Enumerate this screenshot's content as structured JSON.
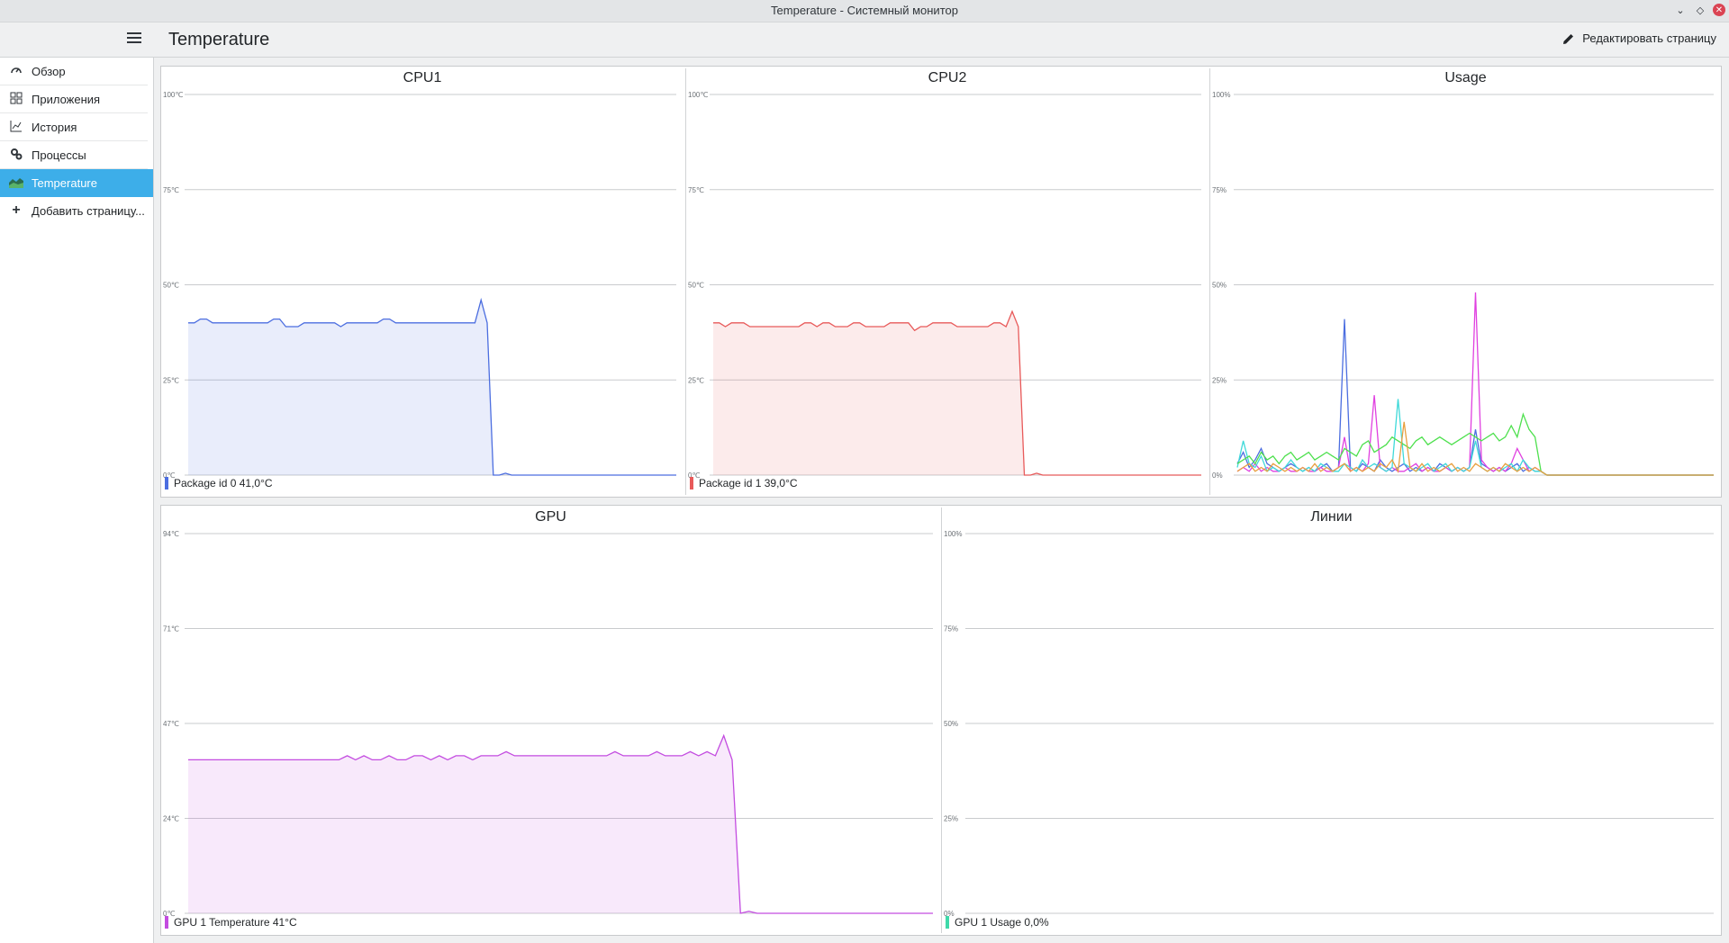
{
  "window": {
    "title": "Temperature - Системный монитор"
  },
  "header": {
    "page_title": "Temperature",
    "edit_label": "Редактировать страницу"
  },
  "sidebar": {
    "items": [
      {
        "label": "Обзор",
        "icon": "speedometer-icon"
      },
      {
        "label": "Приложения",
        "icon": "grid-icon"
      },
      {
        "label": "История",
        "icon": "history-chart-icon"
      },
      {
        "label": "Процессы",
        "icon": "gears-icon"
      },
      {
        "label": "Temperature",
        "icon": "area-chart-icon",
        "active": true
      },
      {
        "label": "Добавить страницу...",
        "icon": "plus-icon"
      }
    ]
  },
  "colors": {
    "accent": "#3daee9",
    "cpu1": "#4c6ee0",
    "cpu2": "#e85a5a",
    "gpu": "#c34ce0",
    "lines": "#3fd9a9"
  },
  "chart_data": [
    {
      "id": "cpu1",
      "type": "area",
      "title": "CPU1",
      "yticks": [
        "100℃",
        "75℃",
        "50℃",
        "25℃",
        "0℃"
      ],
      "ylim": [
        0,
        100
      ],
      "series": [
        {
          "name": "Package id 0",
          "color": "#4c6ee0",
          "values": [
            40,
            40,
            41,
            41,
            40,
            40,
            40,
            40,
            40,
            40,
            40,
            40,
            40,
            40,
            41,
            41,
            39,
            39,
            39,
            40,
            40,
            40,
            40,
            40,
            40,
            39,
            40,
            40,
            40,
            40,
            40,
            40,
            41,
            41,
            40,
            40,
            40,
            40,
            40,
            40,
            40,
            40,
            40,
            40,
            40,
            40,
            40,
            40,
            46,
            40,
            0,
            0,
            0.5,
            0,
            0,
            0,
            0,
            0,
            0,
            0,
            0,
            0,
            0,
            0,
            0,
            0,
            0,
            0,
            0,
            0,
            0,
            0,
            0,
            0,
            0,
            0,
            0,
            0,
            0,
            0,
            0
          ]
        }
      ],
      "legend": "Package id 0 41,0°C"
    },
    {
      "id": "cpu2",
      "type": "area",
      "title": "CPU2",
      "yticks": [
        "100℃",
        "75℃",
        "50℃",
        "25℃",
        "0℃"
      ],
      "ylim": [
        0,
        100
      ],
      "series": [
        {
          "name": "Package id 1",
          "color": "#e85a5a",
          "values": [
            40,
            40,
            39,
            40,
            40,
            40,
            39,
            39,
            39,
            39,
            39,
            39,
            39,
            39,
            39,
            40,
            40,
            39,
            40,
            40,
            39,
            39,
            39,
            40,
            40,
            39,
            39,
            39,
            39,
            40,
            40,
            40,
            40,
            38,
            39,
            39,
            40,
            40,
            40,
            40,
            39,
            39,
            39,
            39,
            39,
            39,
            40,
            40,
            39,
            43,
            39,
            0,
            0,
            0.5,
            0,
            0,
            0,
            0,
            0,
            0,
            0,
            0,
            0,
            0,
            0,
            0,
            0,
            0,
            0,
            0,
            0,
            0,
            0,
            0,
            0,
            0,
            0,
            0,
            0,
            0,
            0
          ]
        }
      ],
      "legend": "Package id 1 39,0°C"
    },
    {
      "id": "usage",
      "type": "line",
      "title": "Usage",
      "yticks": [
        "100%",
        "75%",
        "50%",
        "25%",
        "0%"
      ],
      "ylim": [
        0,
        100
      ],
      "series": [
        {
          "color": "#4c6ee0",
          "values": [
            3,
            6,
            2,
            4,
            7,
            3,
            2,
            1,
            2,
            3,
            2,
            1,
            2,
            1,
            2,
            3,
            1,
            2,
            41,
            2,
            1,
            3,
            2,
            1,
            4,
            2,
            1,
            2,
            3,
            1,
            2,
            1,
            2,
            1,
            3,
            2,
            1,
            2,
            1,
            2,
            12,
            3,
            2,
            1,
            2,
            1,
            2,
            3,
            1,
            2,
            1,
            1,
            0,
            0,
            0,
            0,
            0,
            0,
            0,
            0,
            0,
            0,
            0,
            0,
            0,
            0,
            0,
            0,
            0,
            0,
            0,
            0,
            0,
            0,
            0,
            0,
            0,
            0,
            0,
            0,
            0
          ]
        },
        {
          "color": "#e040e0",
          "values": [
            1,
            2,
            1,
            3,
            1,
            2,
            1,
            1,
            2,
            1,
            1,
            2,
            1,
            1,
            2,
            1,
            1,
            2,
            10,
            1,
            2,
            1,
            3,
            21,
            2,
            1,
            2,
            1,
            1,
            2,
            3,
            1,
            2,
            1,
            1,
            2,
            1,
            2,
            1,
            2,
            48,
            4,
            2,
            1,
            2,
            1,
            3,
            7,
            4,
            1,
            2,
            1,
            0,
            0,
            0,
            0,
            0,
            0,
            0,
            0,
            0,
            0,
            0,
            0,
            0,
            0,
            0,
            0,
            0,
            0,
            0,
            0,
            0,
            0,
            0,
            0,
            0,
            0,
            0,
            0,
            0
          ]
        },
        {
          "color": "#3fd9d9",
          "values": [
            2,
            9,
            3,
            2,
            5,
            1,
            2,
            1,
            2,
            4,
            2,
            1,
            2,
            1,
            3,
            2,
            1,
            1,
            3,
            2,
            1,
            4,
            2,
            3,
            2,
            1,
            2,
            20,
            3,
            2,
            1,
            2,
            3,
            1,
            2,
            3,
            1,
            2,
            1,
            2,
            9,
            2,
            1,
            2,
            1,
            2,
            3,
            1,
            4,
            2,
            1,
            1,
            0,
            0,
            0,
            0,
            0,
            0,
            0,
            0,
            0,
            0,
            0,
            0,
            0,
            0,
            0,
            0,
            0,
            0,
            0,
            0,
            0,
            0,
            0,
            0,
            0,
            0,
            0,
            0,
            0
          ]
        },
        {
          "color": "#4ee04e",
          "values": [
            3,
            4,
            5,
            3,
            6,
            4,
            5,
            3,
            5,
            6,
            4,
            5,
            6,
            4,
            5,
            6,
            5,
            4,
            7,
            6,
            5,
            8,
            9,
            6,
            7,
            8,
            10,
            9,
            8,
            7,
            9,
            10,
            8,
            9,
            10,
            9,
            8,
            9,
            10,
            11,
            10,
            9,
            10,
            11,
            9,
            10,
            13,
            10,
            16,
            12,
            10,
            1,
            0,
            0,
            0,
            0,
            0,
            0,
            0,
            0,
            0,
            0,
            0,
            0,
            0,
            0,
            0,
            0,
            0,
            0,
            0,
            0,
            0,
            0,
            0,
            0,
            0,
            0,
            0,
            0,
            0
          ]
        },
        {
          "color": "#e8a040",
          "values": [
            1,
            2,
            3,
            1,
            2,
            1,
            3,
            2,
            1,
            2,
            1,
            2,
            1,
            3,
            1,
            2,
            1,
            2,
            3,
            1,
            2,
            1,
            2,
            1,
            3,
            2,
            4,
            1,
            14,
            2,
            1,
            3,
            1,
            2,
            1,
            2,
            3,
            1,
            2,
            1,
            3,
            2,
            1,
            2,
            1,
            3,
            2,
            1,
            2,
            1,
            2,
            1,
            0,
            0,
            0,
            0,
            0,
            0,
            0,
            0,
            0,
            0,
            0,
            0,
            0,
            0,
            0,
            0,
            0,
            0,
            0,
            0,
            0,
            0,
            0,
            0,
            0,
            0,
            0,
            0,
            0
          ]
        }
      ]
    },
    {
      "id": "gpu",
      "type": "area",
      "title": "GPU",
      "yticks": [
        "94℃",
        "71℃",
        "47℃",
        "24℃",
        "0℃"
      ],
      "ylim": [
        0,
        94
      ],
      "series": [
        {
          "name": "GPU 1 Temperature",
          "color": "#c34ce0",
          "values": [
            38,
            38,
            38,
            38,
            38,
            38,
            38,
            38,
            38,
            38,
            38,
            38,
            38,
            38,
            38,
            38,
            38,
            38,
            38,
            39,
            38,
            39,
            38,
            38,
            39,
            38,
            38,
            39,
            39,
            38,
            39,
            38,
            39,
            39,
            38,
            39,
            39,
            39,
            40,
            39,
            39,
            39,
            39,
            39,
            39,
            39,
            39,
            39,
            39,
            39,
            39,
            40,
            39,
            39,
            39,
            39,
            40,
            39,
            39,
            39,
            40,
            39,
            40,
            39,
            44,
            38,
            0,
            0.5,
            0,
            0,
            0,
            0,
            0,
            0,
            0,
            0,
            0,
            0,
            0,
            0,
            0,
            0,
            0,
            0,
            0,
            0,
            0,
            0,
            0,
            0
          ]
        }
      ],
      "legend": "GPU 1 Temperature 41°C"
    },
    {
      "id": "lines",
      "type": "line",
      "title": "Линии",
      "yticks": [
        "100%",
        "75%",
        "50%",
        "25%",
        "0%"
      ],
      "ylim": [
        0,
        100
      ],
      "series": [
        {
          "name": "GPU 1 Usage",
          "color": "#3fd9a9",
          "values": []
        }
      ],
      "legend": "GPU 1 Usage 0,0%"
    }
  ]
}
